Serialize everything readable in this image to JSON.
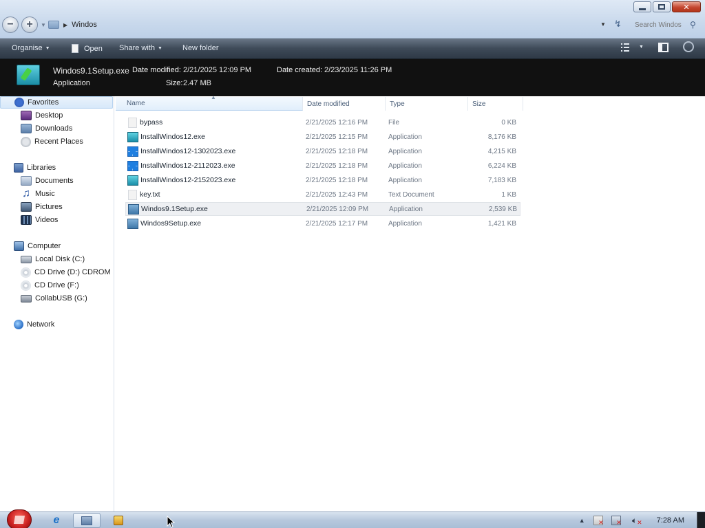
{
  "window": {
    "controls": [
      "minimize",
      "maximize",
      "close"
    ]
  },
  "address": {
    "crumbs": [
      "Windos"
    ],
    "search_placeholder": "Search Windos"
  },
  "toolbar": {
    "organise": "Organise",
    "open": "Open",
    "share_with": "Share with",
    "new_folder": "New folder"
  },
  "details": {
    "name": "Windos9.1Setup.exe",
    "type": "Application",
    "date_modified_label": "Date modified:",
    "date_modified": "2/21/2025 12:09 PM",
    "date_created_label": "Date created:",
    "date_created": "2/23/2025 11:26 PM",
    "size_label": "Size:",
    "size": "2.47 MB"
  },
  "nav": {
    "favorites": "Favorites",
    "favorites_items": [
      "Desktop",
      "Downloads",
      "Recent Places"
    ],
    "libraries": "Libraries",
    "libraries_items": [
      "Documents",
      "Music",
      "Pictures",
      "Videos"
    ],
    "computer": "Computer",
    "computer_items": [
      "Local Disk (C:)",
      "CD Drive (D:) CDROM",
      "CD Drive (F:)",
      "CollabUSB (G:)"
    ],
    "network": "Network"
  },
  "columns": [
    "Name",
    "Date modified",
    "Type",
    "Size"
  ],
  "files": [
    {
      "name": "bypass",
      "date": "2/21/2025 12:16 PM",
      "type": "File",
      "size": "0 KB",
      "icon": "blank-file-icon"
    },
    {
      "name": "InstallWindos12.exe",
      "date": "2/21/2025 12:15 PM",
      "type": "Application",
      "size": "8,176 KB",
      "icon": "setup-icon"
    },
    {
      "name": "InstallWindos12-1302023.exe",
      "date": "2/21/2025 12:18 PM",
      "type": "Application",
      "size": "4,215 KB",
      "icon": "windows-logo-icon"
    },
    {
      "name": "InstallWindos12-2112023.exe",
      "date": "2/21/2025 12:18 PM",
      "type": "Application",
      "size": "6,224 KB",
      "icon": "windows-logo-icon"
    },
    {
      "name": "InstallWindos12-2152023.exe",
      "date": "2/21/2025 12:18 PM",
      "type": "Application",
      "size": "7,183 KB",
      "icon": "setup-icon"
    },
    {
      "name": "key.txt",
      "date": "2/21/2025 12:43 PM",
      "type": "Text Document",
      "size": "1 KB",
      "icon": "text-file-icon"
    },
    {
      "name": "Windos9.1Setup.exe",
      "date": "2/21/2025 12:09 PM",
      "type": "Application",
      "size": "2,539 KB",
      "icon": "installer-icon"
    },
    {
      "name": "Windos9Setup.exe",
      "date": "2/21/2025 12:17 PM",
      "type": "Application",
      "size": "1,421 KB",
      "icon": "installer-icon"
    }
  ],
  "taskbar": {
    "clock": "7:28 AM"
  }
}
